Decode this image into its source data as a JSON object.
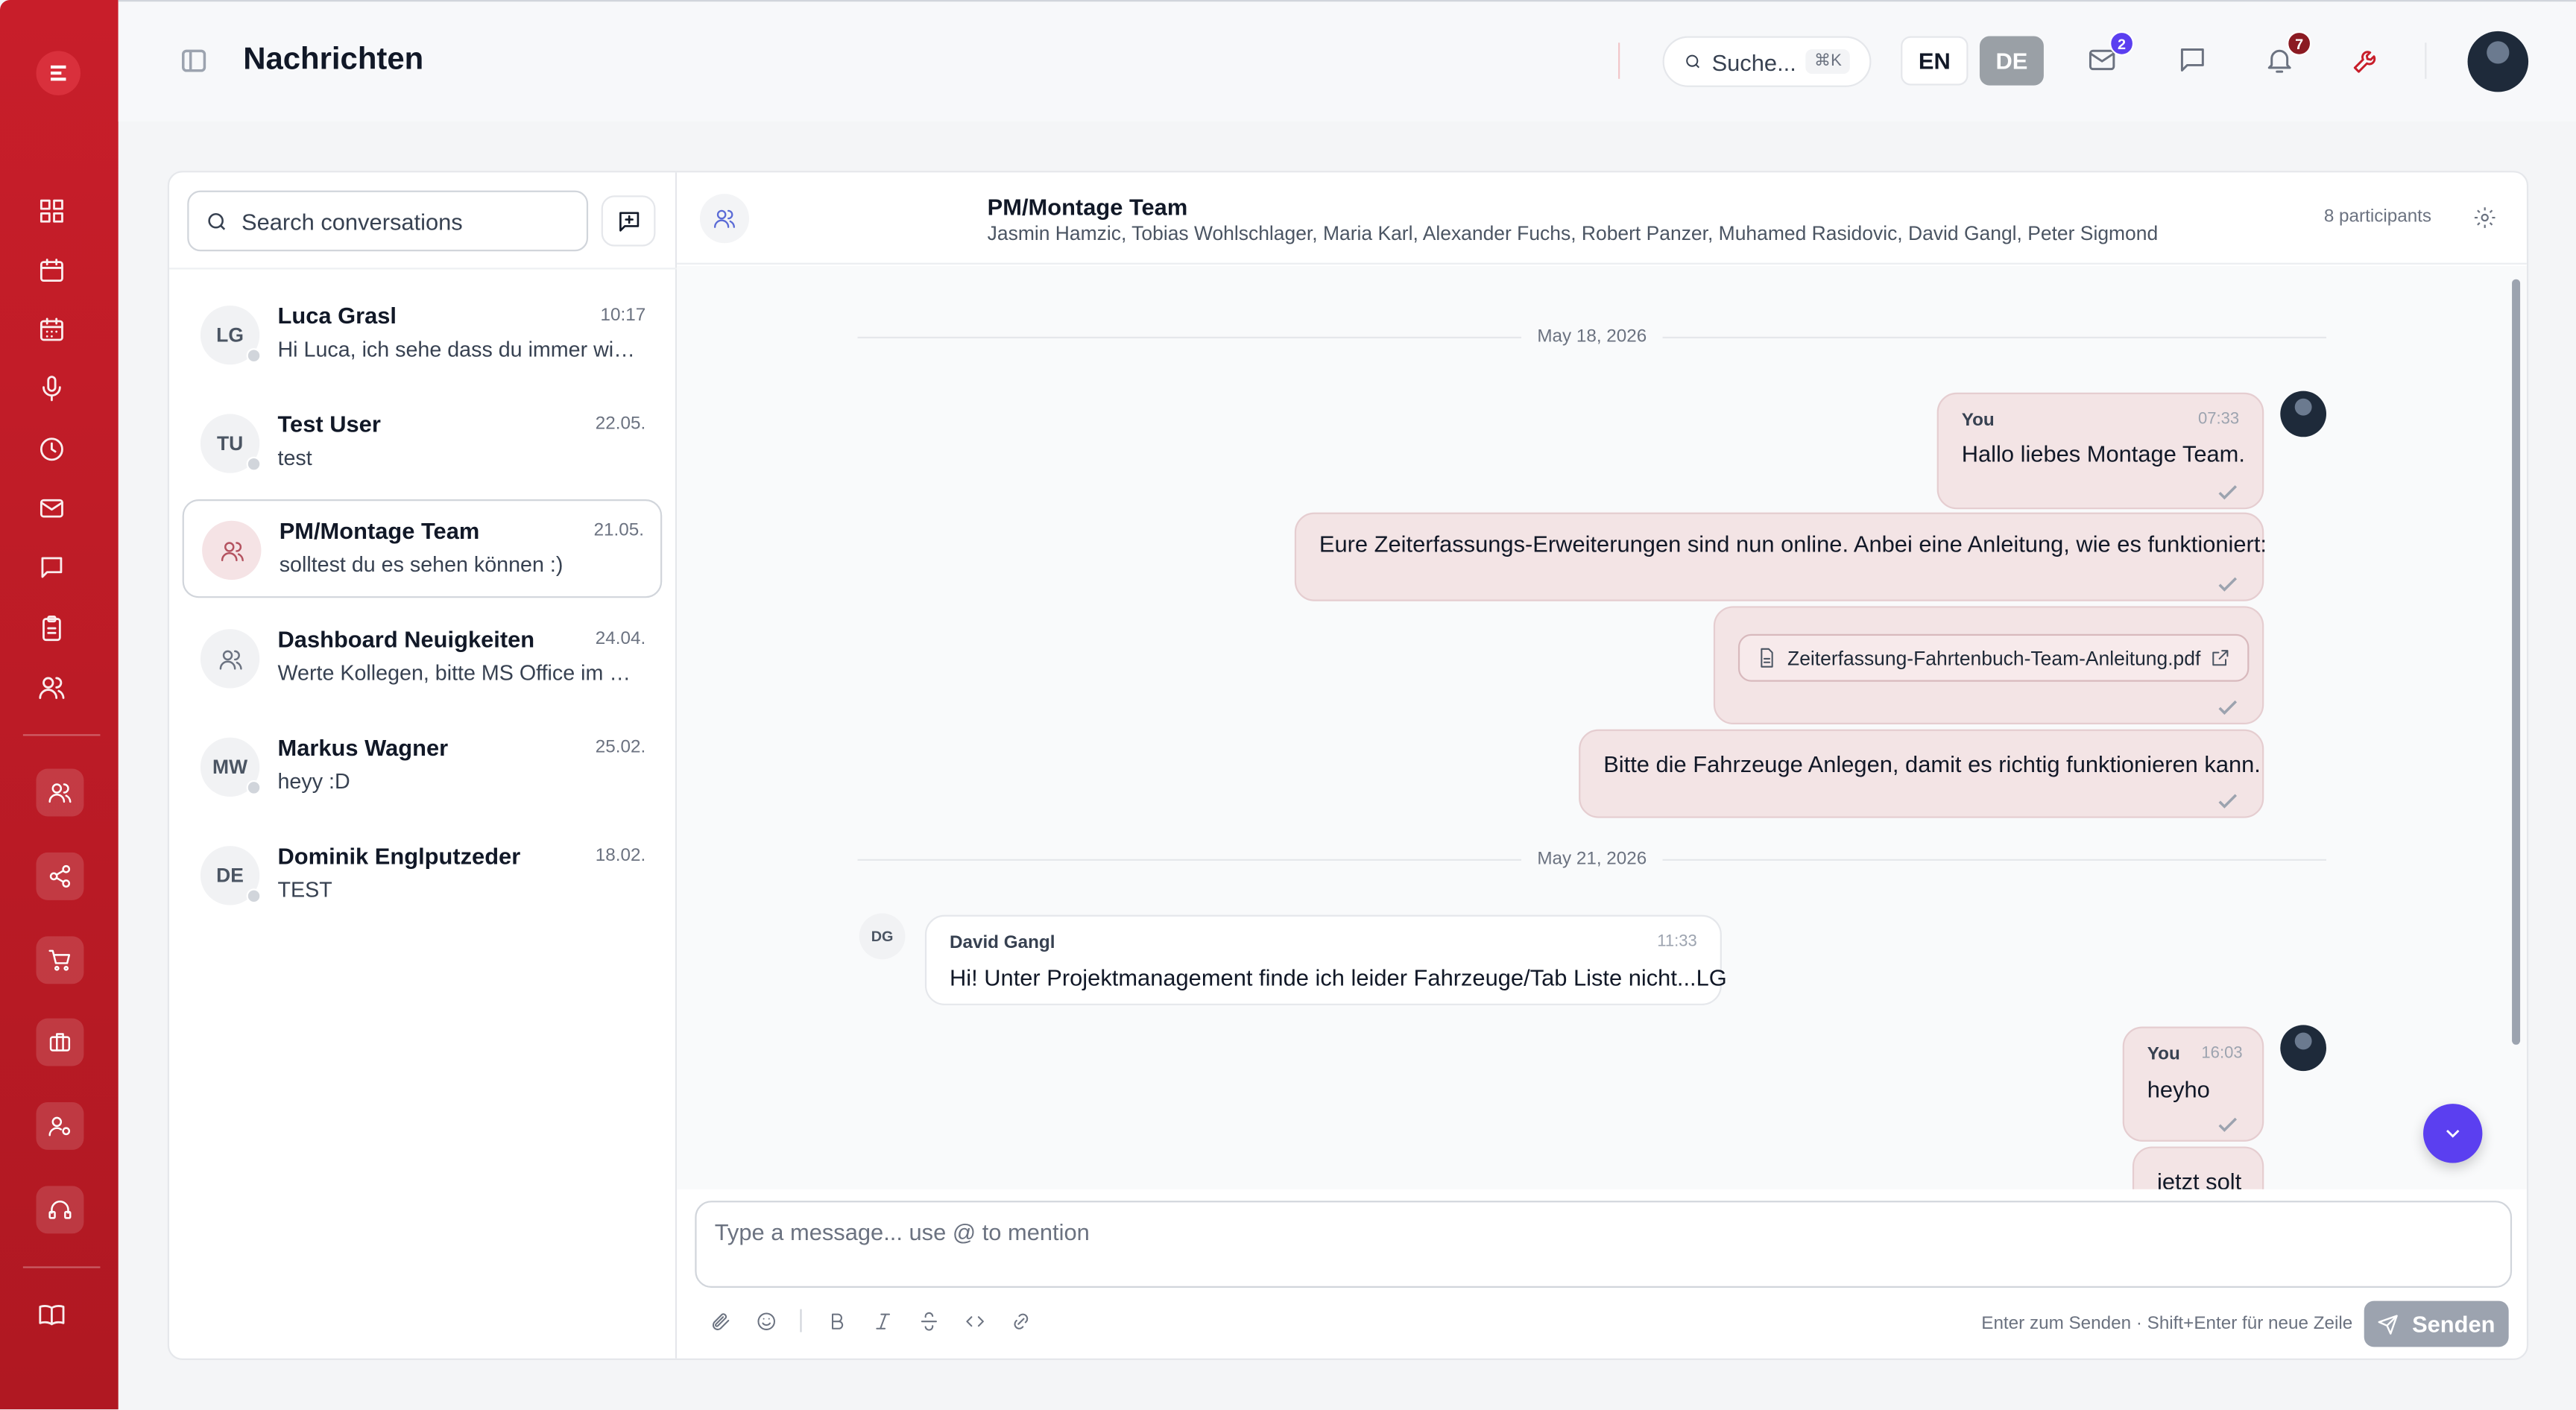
{
  "header": {
    "title": "Nachrichten",
    "search_label": "Suche...",
    "search_shortcut": "⌘K",
    "lang_en": "EN",
    "lang_de": "DE",
    "mail_badge": "2",
    "notif_badge": "7"
  },
  "colors": {
    "brand": "#c81e2a",
    "mail_badge": "#5b3ff0",
    "notif_badge": "#8b1a22",
    "accent": "#5b3ff0"
  },
  "sidebar": {
    "icons": [
      "dashboard-icon",
      "calendar-icon",
      "calendar-grid-icon",
      "microphone-icon",
      "clock-icon",
      "mail-icon",
      "chat-icon",
      "clipboard-icon",
      "users-icon"
    ],
    "group_icons": [
      "team-icon",
      "share-icon",
      "cart-icon",
      "briefcase-icon",
      "user-settings-icon",
      "headset-icon"
    ],
    "bottom_icon": "book-icon"
  },
  "conversations": {
    "search_placeholder": "Search conversations",
    "items": [
      {
        "initials": "LG",
        "name": "Luca Grasl",
        "time": "10:17",
        "preview": "Hi Luca, ich sehe dass du immer wied..."
      },
      {
        "initials": "TU",
        "name": "Test User",
        "time": "22.05.",
        "preview": "test"
      },
      {
        "initials": "",
        "name": "PM/Montage Team",
        "time": "21.05.",
        "preview": "solltest du es sehen können :)"
      },
      {
        "initials": "",
        "name": "Dashboard Neuigkeiten",
        "time": "24.04.",
        "preview": "Werte Kollegen, bitte MS Office im Da..."
      },
      {
        "initials": "MW",
        "name": "Markus Wagner",
        "time": "25.02.",
        "preview": "heyy :D"
      },
      {
        "initials": "DE",
        "name": "Dominik Englputzeder",
        "time": "18.02.",
        "preview": "TEST"
      }
    ]
  },
  "chat": {
    "title": "PM/Montage Team",
    "members": "Jasmin Hamzic, Tobias Wohlschlager, Maria Karl, Alexander Fuchs, Robert Panzer, Muhamed Rasidovic, David Gangl, Peter Sigmond",
    "participants": "8 participants",
    "date1": "May 18, 2026",
    "date2": "May 21, 2026",
    "messages": {
      "m1_sender": "You",
      "m1_time": "07:33",
      "m1_text": "Hallo liebes Montage Team.",
      "m2_text": "Eure Zeiterfassungs-Erweiterungen sind nun online. Anbei eine Anleitung, wie es funktioniert:",
      "m3_file": "Zeiterfassung-Fahrtenbuch-Team-Anleitung.pdf",
      "m4_text": "Bitte die Fahrzeuge Anlegen, damit es richtig funktionieren kann.",
      "m5_initials": "DG",
      "m5_sender": "David Gangl",
      "m5_time": "11:33",
      "m5_text": "Hi! Unter Projektmanagement finde ich leider Fahrzeuge/Tab Liste nicht...LG",
      "m6_sender": "You",
      "m6_time": "16:03",
      "m6_text": "heyho",
      "m7_text": "jetzt solt"
    },
    "composer_placeholder": "Type a message... use @ to mention",
    "hint": "Enter zum Senden · Shift+Enter für neue Zeile",
    "send_label": "Senden"
  }
}
